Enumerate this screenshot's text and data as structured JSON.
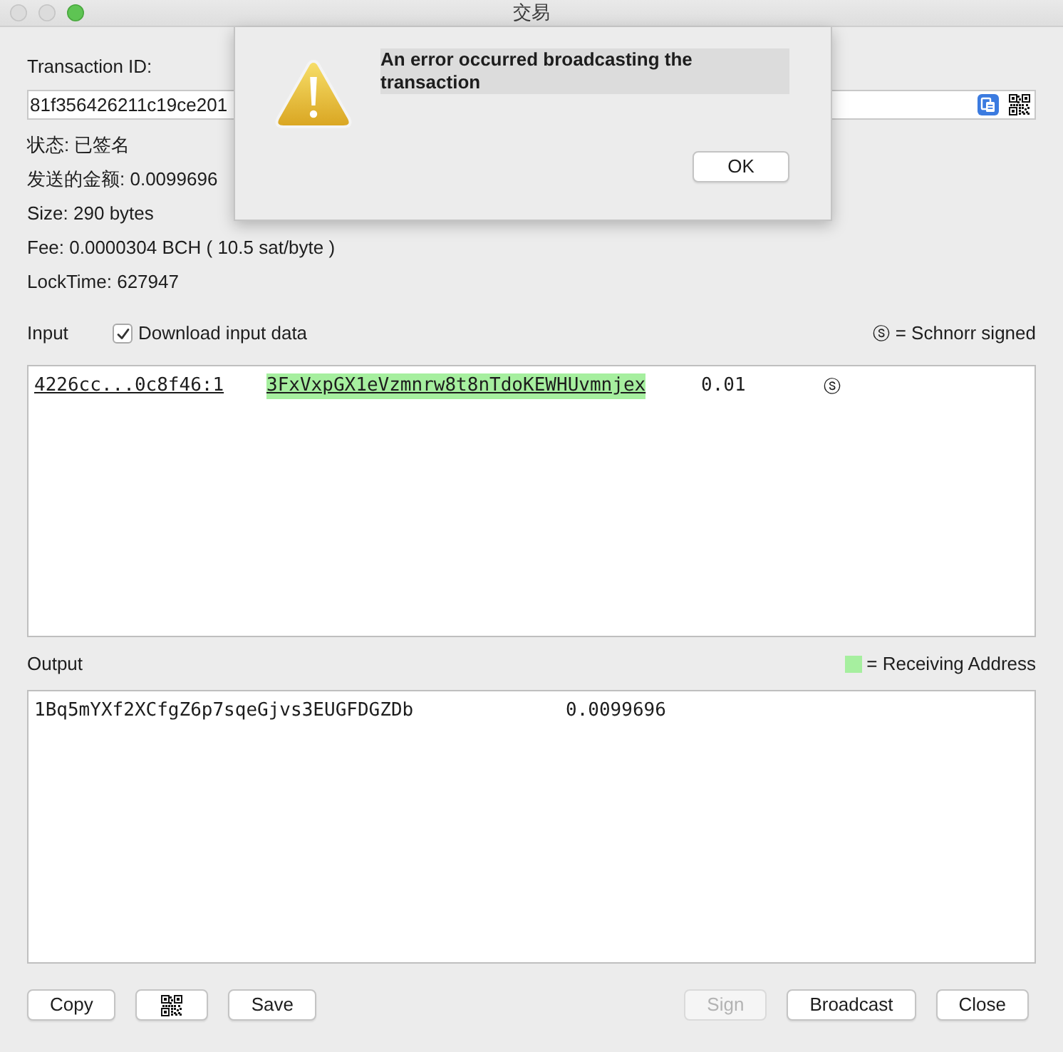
{
  "window": {
    "title": "交易"
  },
  "transaction_id": {
    "label": "Transaction ID:",
    "value": "81f356426211c19ce201"
  },
  "details": [
    "状态: 已签名",
    "发送的金额: 0.0099696",
    "Size: 290 bytes",
    "Fee: 0.0000304 BCH ( 10.5 sat/byte )",
    "LockTime: 627947"
  ],
  "input": {
    "label": "Input",
    "download_input_data": {
      "label": "Download input data",
      "checked": true
    },
    "legend": {
      "symbol": "ⓢ",
      "text": "= Schnorr signed"
    },
    "rows": [
      {
        "outpoint": "4226cc...0c8f46:1",
        "address": "3FxVxpGX1eVzmnrw8t8nTdoKEWHUvmnjex",
        "receiving": true,
        "amount": "0.01",
        "signature_mark": "ⓢ"
      }
    ]
  },
  "output": {
    "label": "Output",
    "legend": {
      "text": "= Receiving Address"
    },
    "rows": [
      {
        "address": "1Bq5mYXf2XCfgZ6p7sqeGjvs3EUGFDGZDb",
        "receiving": false,
        "amount": "0.0099696"
      }
    ]
  },
  "buttons_left": [
    {
      "kind": "text",
      "label": "Copy",
      "disabled": false
    },
    {
      "kind": "qr",
      "disabled": false
    },
    {
      "kind": "text",
      "label": "Save",
      "disabled": false
    }
  ],
  "buttons_right": [
    {
      "kind": "text",
      "label": "Sign",
      "disabled": true
    },
    {
      "kind": "text",
      "label": "Broadcast",
      "disabled": false
    },
    {
      "kind": "text",
      "label": "Close",
      "disabled": false
    }
  ],
  "dialog": {
    "message": "An error occurred broadcasting the transaction",
    "message_selected": true,
    "buttons": [
      {
        "label": "OK"
      }
    ]
  }
}
